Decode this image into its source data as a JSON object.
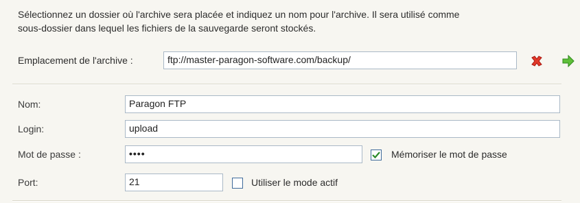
{
  "description": {
    "line1": "Sélectionnez un dossier où l'archive sera placée et indiquez un nom pour l'archive. Il sera utilisé comme",
    "line2": "sous-dossier dans lequel les fichiers de la sauvegarde seront stockés."
  },
  "archive": {
    "label": "Emplacement de l'archive :",
    "value": "ftp://master-paragon-software.com/backup/"
  },
  "form": {
    "name_label": "Nom:",
    "name_value": "Paragon FTP",
    "login_label": "Login:",
    "login_value": "upload",
    "password_label": "Mot de passe :",
    "password_value": "••••",
    "remember_label": "Mémoriser le mot de passe",
    "remember_checked": true,
    "port_label": "Port:",
    "port_value": "21",
    "active_mode_label": "Utiliser le mode actif",
    "active_mode_checked": false
  },
  "icons": {
    "clear": "delete-x-icon",
    "go": "green-arrow-right-icon"
  },
  "colors": {
    "delete_red": "#e23a2a",
    "go_green": "#5fbf3a",
    "check_green": "#2a8a2a"
  }
}
